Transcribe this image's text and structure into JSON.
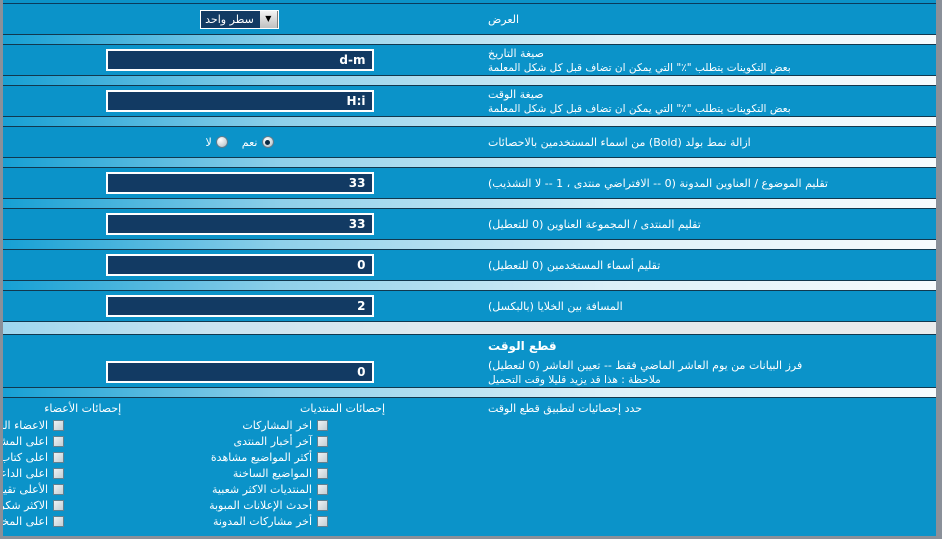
{
  "theme": {
    "page_bg": "#0b93c9",
    "input_bg": "#123a63",
    "input_border": "#ffffff",
    "frame": "#8a9099",
    "text": "#ffffff"
  },
  "rows": {
    "display": {
      "label": "العرض",
      "select": {
        "value": "سطر واحد",
        "arrow_icon": "chevron-down-icon"
      }
    },
    "date_format": {
      "label": "صيغة التاريخ",
      "desc": "بعض التكوينات يتطلب \"٪\" التي يمكن ان تضاف قبل كل شكل المعلمة",
      "value": "d-m"
    },
    "time_format": {
      "label": "صيغة الوقت",
      "desc": "بعض التكوينات يتطلب \"٪\" التي يمكن ان تضاف قبل كل شكل المعلمة",
      "value": "H:i"
    },
    "remove_bold": {
      "label": "ازالة نمط بولد (Bold) من اسماء المستخدمين بالاحصائات",
      "options": [
        {
          "label": "نعم",
          "checked": true
        },
        {
          "label": "لا",
          "checked": false
        }
      ]
    },
    "trim_topic_titles": {
      "label": "تقليم الموضوع / العناوين المدونة (0 -- الافتراضي منتدى ، 1 -- لا التشذيب)",
      "value": "33"
    },
    "trim_forum_titles": {
      "label": "تقليم المنتدى / المجموعة العناوين (0 للتعطيل)",
      "value": "33"
    },
    "trim_usernames": {
      "label": "تقليم أسماء المستخدمين (0 للتعطيل)",
      "value": "0"
    },
    "cell_spacing": {
      "label": "المسافة بين الخلايا (بالبكسل)",
      "value": "2"
    },
    "time_cutoff_header": {
      "label": "قطع الوقت"
    },
    "time_cutoff": {
      "label": "فرز البيانات من يوم العاشر الماضي فقط -- تعيين العاشر (0 لتعطيل)",
      "desc": "ملاحظة : هذا قد يزيد قليلا وقت التحميل",
      "value": "0"
    }
  },
  "stats_section": {
    "heading": "حدد إحصائيات لتطبيق قطع الوقت",
    "forum_stats": {
      "title": "إحصائات المنتديات",
      "items": [
        {
          "label": "اخر المشاركات",
          "checked": false
        },
        {
          "label": "آخر أخبار المنتدى",
          "checked": false
        },
        {
          "label": "أكثر المواضيع مشاهدة",
          "checked": false
        },
        {
          "label": "المواضيع الساخنة",
          "checked": false
        },
        {
          "label": "المنتديات الاكثر شعبية",
          "checked": false
        },
        {
          "label": "أحدث الإعلانات المبوبة",
          "checked": false
        },
        {
          "label": "أخر مشاركات المدونة",
          "checked": false
        }
      ]
    },
    "member_stats": {
      "title": "إحصائات الأعضاء",
      "items": [
        {
          "label": "الاعضاء الجدد",
          "checked": false
        },
        {
          "label": "اعلى المشاركين",
          "checked": false
        },
        {
          "label": "اعلى كتاب المواضيع",
          "checked": false
        },
        {
          "label": "اعلى الداعين",
          "checked": false
        },
        {
          "label": "الأعلى تقييم",
          "checked": false
        },
        {
          "label": "الاكثر شكراً",
          "checked": false
        },
        {
          "label": "اعلى المخالفين",
          "checked": false
        }
      ]
    }
  }
}
